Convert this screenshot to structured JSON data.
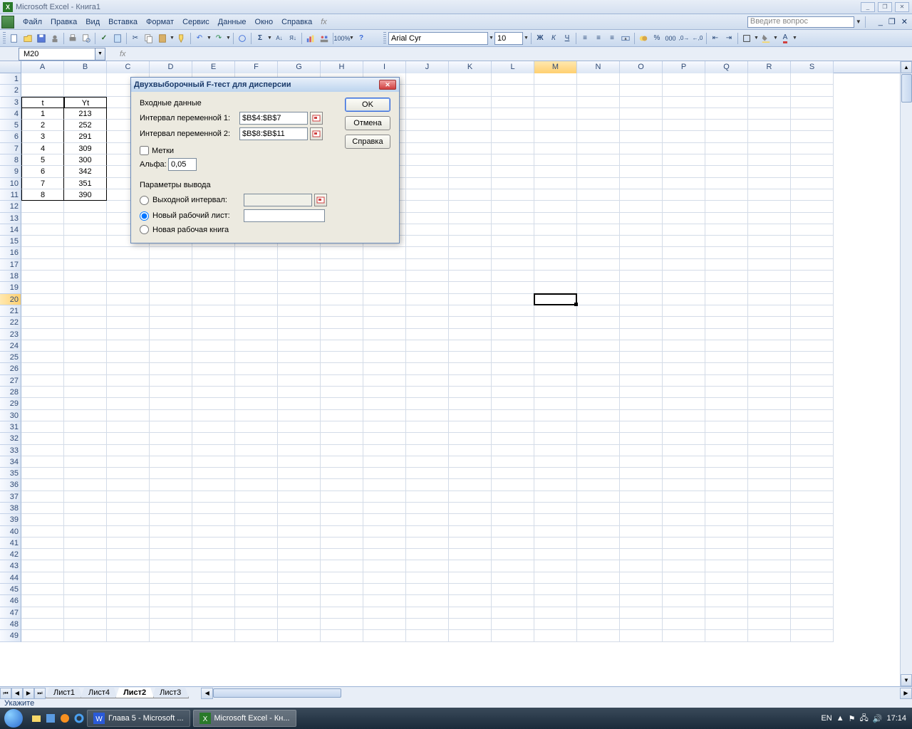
{
  "app": {
    "title": "Microsoft Excel - Книга1",
    "window_controls": {
      "minimize": "_",
      "restore": "❐",
      "close": "✕"
    }
  },
  "menu": {
    "items": [
      "Файл",
      "Правка",
      "Вид",
      "Вставка",
      "Формат",
      "Сервис",
      "Данные",
      "Окно",
      "Справка"
    ],
    "fx_label": "fx",
    "ask_placeholder": "Введите вопрос"
  },
  "toolbar": {
    "font_name": "Arial Cyr",
    "font_size": "10"
  },
  "namebox": {
    "value": "M20"
  },
  "columns": [
    "A",
    "B",
    "C",
    "D",
    "E",
    "F",
    "G",
    "H",
    "I",
    "J",
    "K",
    "L",
    "M",
    "N",
    "O",
    "P",
    "Q",
    "R",
    "S"
  ],
  "selected_column": "M",
  "selected_row": 20,
  "row_count": 49,
  "data_table": {
    "headers": {
      "c1": "t",
      "c2": "Yt"
    },
    "rows": [
      {
        "t": "1",
        "y": "213"
      },
      {
        "t": "2",
        "y": "252"
      },
      {
        "t": "3",
        "y": "291"
      },
      {
        "t": "4",
        "y": "309"
      },
      {
        "t": "5",
        "y": "300"
      },
      {
        "t": "6",
        "y": "342"
      },
      {
        "t": "7",
        "y": "351"
      },
      {
        "t": "8",
        "y": "390"
      }
    ]
  },
  "dialog": {
    "title": "Двухвыборочный F-тест для дисперсии",
    "input_section": "Входные данные",
    "var1_label": "Интервал переменной 1:",
    "var1_value": "$B$4:$B$7",
    "var2_label": "Интервал переменной 2:",
    "var2_value": "$B$8:$B$11",
    "labels_cb": "Метки",
    "alpha_label": "Альфа:",
    "alpha_value": "0,05",
    "output_section": "Параметры вывода",
    "out_range": "Выходной интервал:",
    "out_sheet": "Новый рабочий лист:",
    "out_book": "Новая рабочая книга",
    "ok": "OK",
    "cancel": "Отмена",
    "help": "Справка"
  },
  "sheets": {
    "tabs": [
      "Лист1",
      "Лист4",
      "Лист2",
      "Лист3"
    ],
    "active": "Лист2"
  },
  "status": {
    "text": "Укажите"
  },
  "taskbar": {
    "items": [
      {
        "icon": "word",
        "label": "Глава 5 - Microsoft ..."
      },
      {
        "icon": "excel",
        "label": "Microsoft Excel - Кн..."
      }
    ],
    "lang": "EN",
    "time": "17:14"
  }
}
